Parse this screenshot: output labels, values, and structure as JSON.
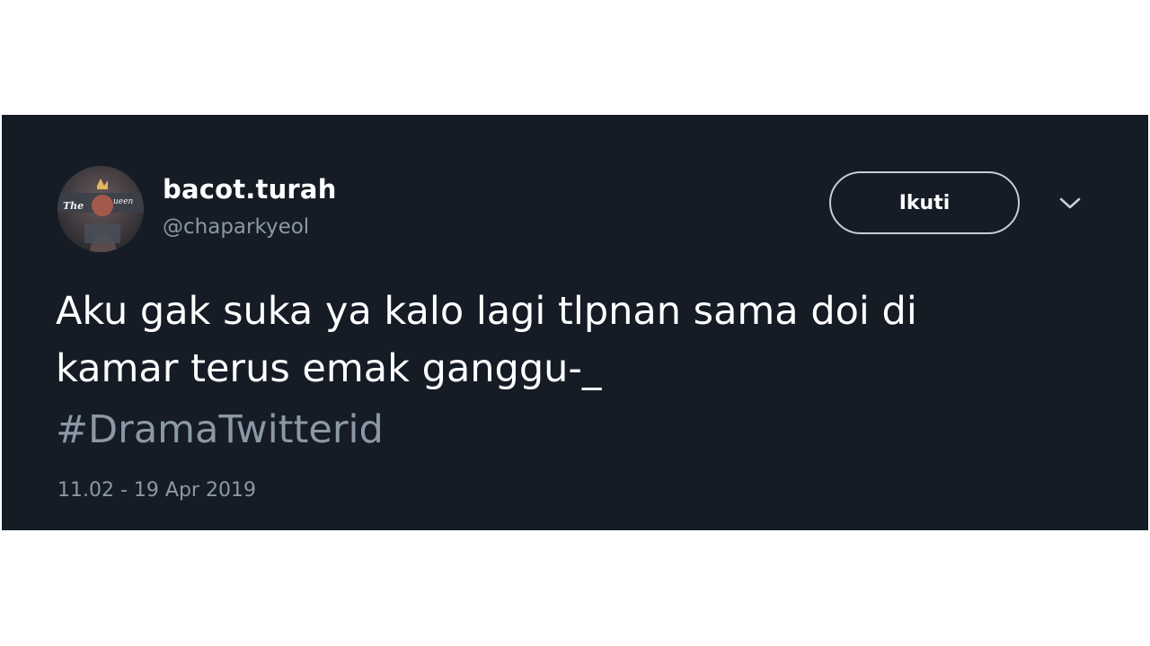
{
  "tweet": {
    "author": {
      "display_name": "bacot.turah",
      "handle": "@chaparkyeol",
      "avatar_icon": "profile-avatar"
    },
    "follow_button_label": "Ikuti",
    "more_icon": "chevron-down-icon",
    "text_lines": [
      "Aku gak suka ya kalo lagi tlpnan sama doi di",
      "kamar terus emak ganggu-_"
    ],
    "hashtag": "#DramaTwitterid",
    "timestamp": "11.02 - 19 Apr 2019"
  },
  "colors": {
    "card_background": "#151c26",
    "secondary_text": "#8b98a5",
    "button_border": "#c6cdd4",
    "page_background": "#ffffff"
  }
}
